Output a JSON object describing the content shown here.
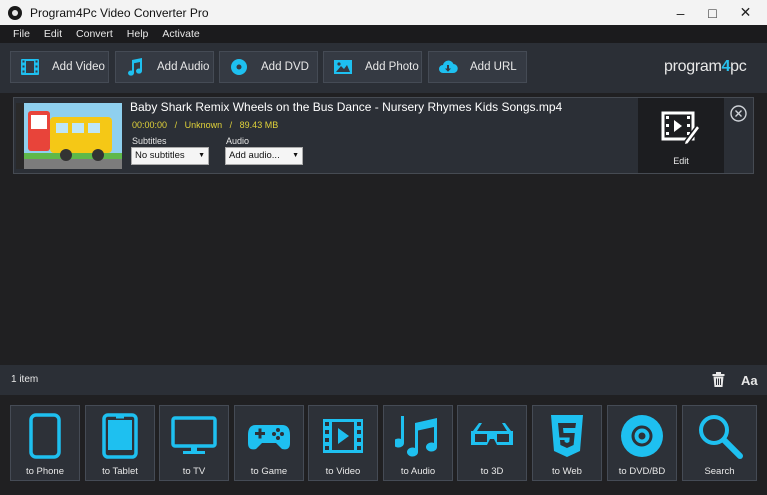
{
  "window": {
    "title": "Program4Pc Video Converter Pro"
  },
  "menu": [
    "File",
    "Edit",
    "Convert",
    "Help",
    "Activate"
  ],
  "toolbar": {
    "buttons": [
      {
        "label": "Add Video",
        "icon": "film-icon"
      },
      {
        "label": "Add Audio",
        "icon": "music-note-icon"
      },
      {
        "label": "Add DVD",
        "icon": "disc-icon"
      },
      {
        "label": "Add Photo",
        "icon": "image-icon"
      },
      {
        "label": "Add URL",
        "icon": "cloud-download-icon"
      }
    ],
    "logo_prefix": "program",
    "logo_four": "4",
    "logo_suffix": "pc"
  },
  "file": {
    "name": "Baby Shark Remix  Wheels on the Bus Dance - Nursery Rhymes  Kids Songs.mp4",
    "duration": "00:00:00",
    "resolution": "Unknown",
    "size": "89.43 MB",
    "separator": "/",
    "subtitles_label": "Subtitles",
    "subtitles_value": "No subtitles",
    "audio_label": "Audio",
    "audio_value": "Add audio...",
    "edit_label": "Edit"
  },
  "status": {
    "count": "1 item",
    "font_label": "Aa"
  },
  "profiles": [
    {
      "label": "to Phone",
      "icon": "phone-icon"
    },
    {
      "label": "to Tablet",
      "icon": "tablet-icon"
    },
    {
      "label": "to TV",
      "icon": "tv-icon"
    },
    {
      "label": "to Game",
      "icon": "gamepad-icon"
    },
    {
      "label": "to Video",
      "icon": "video-film-icon"
    },
    {
      "label": "to Audio",
      "icon": "music-notes-icon"
    },
    {
      "label": "to 3D",
      "icon": "3d-glasses-icon"
    },
    {
      "label": "to Web",
      "icon": "html5-icon"
    },
    {
      "label": "to DVD/BD",
      "icon": "dvd-icon"
    },
    {
      "label": "Search",
      "icon": "search-icon"
    }
  ],
  "colors": {
    "accent": "#1ec0f0",
    "meta_text": "#e0d23a",
    "panel": "#2b2f36",
    "background": "#202022"
  }
}
